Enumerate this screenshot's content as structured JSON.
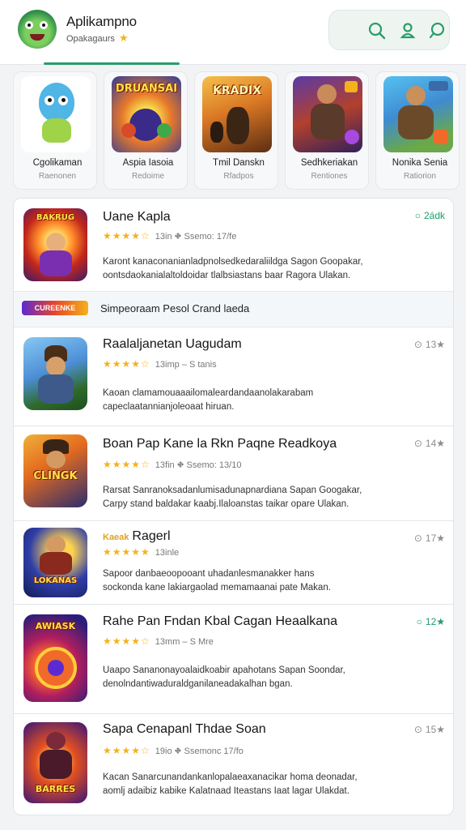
{
  "header": {
    "title": "Aplikampno",
    "subtitle": "Opakagaurs",
    "subtitle_star": "★",
    "logo_icon": "frog-mascot-icon",
    "actions": [
      {
        "icon": "search-icon"
      },
      {
        "icon": "profile-icon"
      },
      {
        "icon": "chat-icon"
      }
    ],
    "accent_color": "#2a9d6a"
  },
  "featured": [
    {
      "name": "Cgolikaman",
      "sub": "Raenonen",
      "art_text": ""
    },
    {
      "name": "Aspia Iasoia",
      "sub": "Redoime",
      "art_text": "DRUANSAI"
    },
    {
      "name": "Tmil Danskn",
      "sub": "Rfadpos",
      "art_text": "KRADIX"
    },
    {
      "name": "Sedhkeriakan",
      "sub": "Rentiones",
      "art_text": ""
    },
    {
      "name": "Nonika Senia",
      "sub": "Ratiorion",
      "art_text": ""
    }
  ],
  "list": {
    "items": [
      {
        "title": "Uane Kapla",
        "stars": "★★★★☆",
        "meta": "13in ⛖ Ssemo: 17/fe",
        "desc_1": "Karont kanaconanianladpnolsedkedaraliildga Sagon Goopakar,",
        "desc_2": "oontsdaokanialaltoldoidar tlalbsiastans baar Ragora Ulakan.",
        "badge_icon": "○",
        "badge": "2ádk",
        "art_text": "BAKRUG"
      },
      {
        "title": "Raalaljanetan Uagudam",
        "stars": "★★★★☆",
        "meta": "13imp – S tanis",
        "desc_1": "Kaoan clamamouaaailomaleardandaanolakarabam",
        "desc_2": "capeclaatannianjoleoaat hiruan.",
        "badge_icon": "⊙",
        "badge": "13★",
        "art_text": ""
      },
      {
        "title": "Boan Pap Kane la Rkn Paqne Readkoya",
        "stars": "★★★★☆",
        "meta": "13fin ⛖ Ssemo: 13/10",
        "desc_1": "Rarsat Sanranoksadanlumisadunapnardiana Sapan Googakar,",
        "desc_2": "Carpy stand baldakar kaabj.Ilaloanstas taikar opare Ulakan.",
        "badge_icon": "⊙",
        "badge": "14★",
        "art_text": "CLINGK"
      },
      {
        "title": "Ragerl",
        "title_prefix": "Kaeak",
        "stars": "★★★★★",
        "meta": "13inle",
        "desc_1": "Sapoor danbaeoopooant uhadanlesmanakker hans",
        "desc_2": "sockonda kane lakiargaolad memamaanai pate Makan.",
        "badge_icon": "⊙",
        "badge": "17★",
        "art_text": "LOKANAS"
      },
      {
        "title": "Rahe Pan Fndan Kbal Cagan Heaalkana",
        "stars": "★★★★☆",
        "meta": "13mm – S Mre",
        "desc_1": "Uaapo Sananonayoalaidkoabir apahotans Sapan Soondar,",
        "desc_2": "denolndantiwaduraldganilaneadakalhan bgan.",
        "badge_icon": "○",
        "badge": "12★",
        "art_text": "AWIASK"
      },
      {
        "title": "Sapa Cenapanl Thdae Soan",
        "stars": "★★★★☆",
        "meta": "19io ⛖ Ssemonc 17/fo",
        "desc_1": "Kacan Sanarcunandankanlopalaeaxanacikar homa deonadar,",
        "desc_2": "aomlj adaibiz kabike Kalatnaad Iteastans Iaat lagar Ulakdat.",
        "badge_icon": "⊙",
        "badge": "15★",
        "art_text": "BARRES"
      }
    ],
    "promo": {
      "tag": "CUREENKE",
      "text": "Simpeoraam Pesol Crand laeda"
    }
  }
}
